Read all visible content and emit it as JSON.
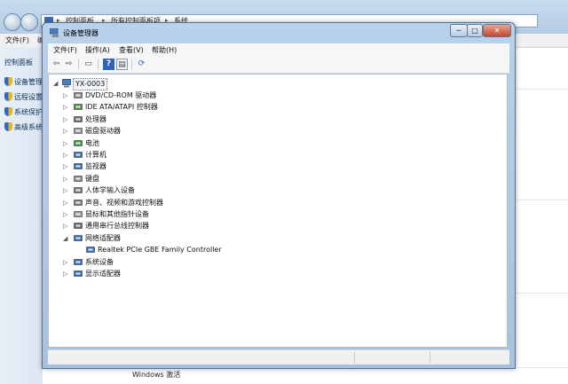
{
  "background_window": {
    "breadcrumb": [
      "控制面板",
      "所有控制面板项",
      "系统"
    ],
    "menu": [
      "文件(F)",
      "编"
    ],
    "left_panel": {
      "home_link": "控制面板",
      "items": [
        "设备管理",
        "远程设置",
        "系统保护",
        "高级系统"
      ]
    },
    "status_text": "Windows 激活"
  },
  "device_manager": {
    "title": "设备管理器",
    "caption_buttons": {
      "minimize": "─",
      "maximize": "□",
      "close": "✕"
    },
    "menu": [
      "文件(F)",
      "操作(A)",
      "查看(V)",
      "帮助(H)"
    ],
    "toolbar": [
      {
        "name": "back-icon",
        "glyph": "⇦"
      },
      {
        "name": "forward-icon",
        "glyph": "⇨"
      },
      {
        "name": "show-hide-icon",
        "glyph": "▭"
      },
      {
        "name": "help-icon",
        "glyph": "?"
      },
      {
        "name": "properties-icon",
        "glyph": "▤"
      },
      {
        "name": "scan-hardware-icon",
        "glyph": "⟳"
      }
    ],
    "tree": {
      "root": "YX-0003",
      "nodes": [
        {
          "label": "DVD/CD-ROM 驱动器",
          "expanded": false,
          "icon": "dvd-drive-icon",
          "color": "#8a8a8a"
        },
        {
          "label": "IDE ATA/ATAPI 控制器",
          "expanded": false,
          "icon": "ide-controller-icon",
          "color": "#5a8a4a"
        },
        {
          "label": "处理器",
          "expanded": false,
          "icon": "processor-icon",
          "color": "#6e6e6e"
        },
        {
          "label": "磁盘驱动器",
          "expanded": false,
          "icon": "disk-drive-icon",
          "color": "#9a9a9a"
        },
        {
          "label": "电池",
          "expanded": false,
          "icon": "battery-icon",
          "color": "#3f9b3f"
        },
        {
          "label": "计算机",
          "expanded": false,
          "icon": "computer-icon",
          "color": "#3a6fb5"
        },
        {
          "label": "监视器",
          "expanded": false,
          "icon": "monitor-icon",
          "color": "#3a6fb5"
        },
        {
          "label": "键盘",
          "expanded": false,
          "icon": "keyboard-icon",
          "color": "#8c8c8c"
        },
        {
          "label": "人体学输入设备",
          "expanded": false,
          "icon": "hid-icon",
          "color": "#7a7a7a"
        },
        {
          "label": "声音、视频和游戏控制器",
          "expanded": false,
          "icon": "sound-icon",
          "color": "#7f7f7f"
        },
        {
          "label": "鼠标和其他指针设备",
          "expanded": false,
          "icon": "mouse-icon",
          "color": "#9a9a9a"
        },
        {
          "label": "通用串行总线控制器",
          "expanded": false,
          "icon": "usb-icon",
          "color": "#6a6a6a"
        },
        {
          "label": "网络适配器",
          "expanded": true,
          "icon": "network-adapter-icon",
          "color": "#3b72b8",
          "children": [
            {
              "label": "Realtek PCIe GBE Family Controller",
              "icon": "network-card-icon",
              "color": "#3b72b8"
            }
          ]
        },
        {
          "label": "系统设备",
          "expanded": false,
          "icon": "system-device-icon",
          "color": "#3a6fb5"
        },
        {
          "label": "显示适配器",
          "expanded": false,
          "icon": "display-adapter-icon",
          "color": "#3a6fb5"
        }
      ]
    }
  }
}
